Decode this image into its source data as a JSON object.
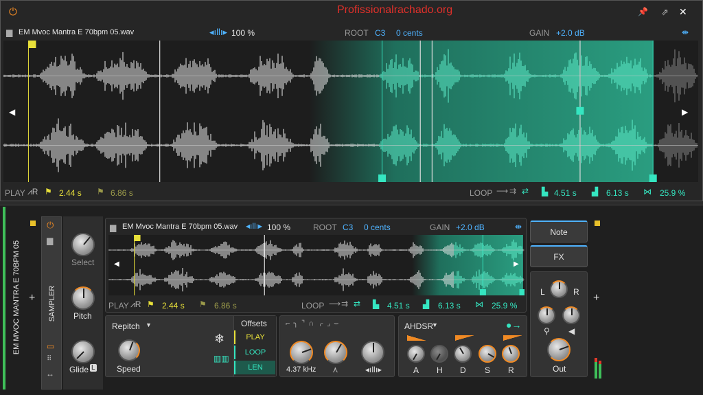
{
  "watermark": "Profissionalrachado.org",
  "top": {
    "file_name": "EM Mvoc Mantra E 70bpm 05.wav",
    "zoom": "100 %",
    "root_label": "ROOT",
    "root_note": "C3",
    "root_cents": "0 cents",
    "gain_label": "GAIN",
    "gain_value": "+2.0 dB",
    "play_label": "PLAY",
    "play_start": "2.44 s",
    "play_end": "6.86 s",
    "loop_label": "LOOP",
    "loop_start": "4.51 s",
    "loop_end": "6.13 s",
    "loop_xfade": "25.9 %"
  },
  "device": {
    "track_name": "EM MVOC MANTRA E 70BPM 05",
    "device_name": "SAMPLER",
    "select_label": "Select",
    "pitch_label": "Pitch",
    "glide_label": "Glide",
    "glide_badge": "L",
    "file_name": "EM Mvoc Mantra E 70bpm 05.wav",
    "zoom": "100 %",
    "root_label": "ROOT",
    "root_note": "C3",
    "root_cents": "0 cents",
    "gain_label": "GAIN",
    "gain_value": "+2.0 dB",
    "play_label": "PLAY",
    "play_start": "2.44 s",
    "play_end": "6.86 s",
    "loop_label": "LOOP",
    "loop_start": "4.51 s",
    "loop_end": "6.13 s",
    "loop_xfade": "25.9 %",
    "mode_select": "Repitch",
    "speed_label": "Speed",
    "offsets_label": "Offsets",
    "offsets": [
      "PLAY",
      "LOOP",
      "LEN"
    ],
    "filter_freq": "4.37 kHz",
    "env_select": "AHDSR",
    "env_labels": [
      "A",
      "H",
      "D",
      "S",
      "R"
    ],
    "note_button": "Note",
    "fx_button": "FX",
    "pan_l": "L",
    "pan_r": "R",
    "out_label": "Out"
  },
  "colors": {
    "accent_orange": "#f08a24",
    "play_yellow": "#e8e03a",
    "loop_teal": "#35e6c1",
    "link_blue": "#4fb3ff"
  }
}
